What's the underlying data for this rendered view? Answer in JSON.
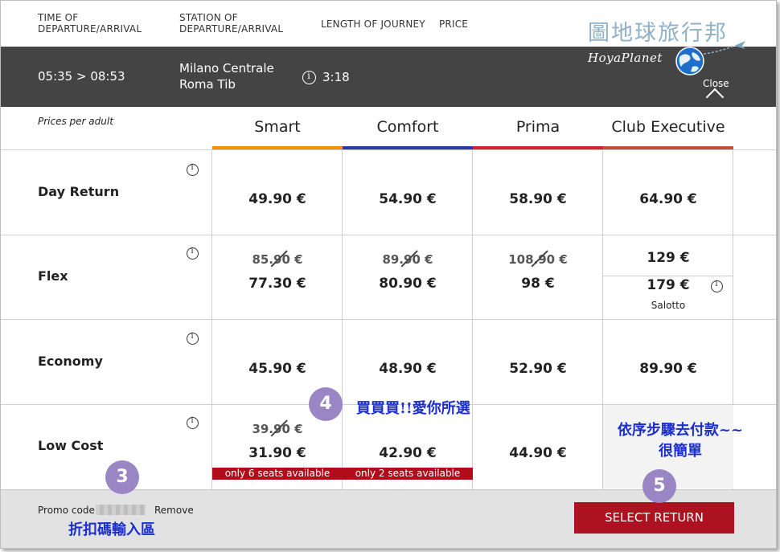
{
  "header": {
    "col_time": "TIME OF DEPARTURE/ARRIVAL",
    "col_station": "STATION OF DEPARTURE/ARRIVAL",
    "col_length": "LENGTH OF JOURNEY",
    "col_price": "PRICE"
  },
  "watermark": {
    "chinese": "圖地球旅行邦",
    "english": "HoyaPlanet"
  },
  "journey": {
    "times": "05:35 > 08:53",
    "from": "Milano Centrale",
    "to": "Roma Tib",
    "duration": "3:18",
    "close_label": "Close"
  },
  "table": {
    "prices_per": "Prices per adult",
    "classes": [
      {
        "name": "Smart",
        "color": "#f39200"
      },
      {
        "name": "Comfort",
        "color": "#2b3aa0"
      },
      {
        "name": "Prima",
        "color": "#d3232f"
      },
      {
        "name": "Club Executive",
        "color": "#c0503c"
      }
    ],
    "rows": {
      "day_return": {
        "label": "Day Return",
        "prices": [
          "49.90 €",
          "54.90 €",
          "58.90 €",
          "64.90 €"
        ]
      },
      "flex": {
        "label": "Flex",
        "old_prices": [
          "85.90 €",
          "89.90 €",
          "108.90 €"
        ],
        "prices": [
          "77.30 €",
          "80.90 €",
          "98 €"
        ],
        "club_price": "129 €",
        "club_salotto_price": "179 €",
        "club_salotto_label": "Salotto"
      },
      "economy": {
        "label": "Economy",
        "prices": [
          "45.90 €",
          "48.90 €",
          "52.90 €",
          "89.90 €"
        ]
      },
      "low_cost": {
        "label": "Low Cost",
        "old_price_smart": "39.90 €",
        "prices": [
          "31.90 €",
          "42.90 €",
          "44.90 €"
        ],
        "seats_smart": "only 6 seats available",
        "seats_comfort": "only 2 seats available"
      }
    }
  },
  "footer": {
    "promo_label": "Promo code",
    "promo_value": "",
    "remove_label": "Remove",
    "select_button": "SELECT RETURN"
  },
  "annotations": {
    "badge3": "3",
    "badge4": "4",
    "badge5": "5",
    "note4": "買買買!!愛你所選",
    "note5_line1": "依序步驟去付款~~",
    "note5_line2": "很簡單",
    "note3": "折扣碼輸入區"
  }
}
